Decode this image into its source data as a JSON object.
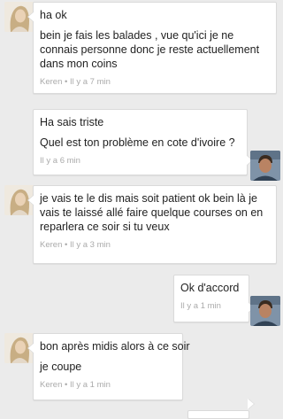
{
  "messages": [
    {
      "sender": "Keren",
      "lines": [
        "ha ok",
        "bein je fais les balades , vue qu'ici je ne connais personne donc je reste actuellement dans mon coins"
      ],
      "meta": "Keren • Il y a 7 min"
    },
    {
      "sender": "me",
      "lines": [
        "Ha sais triste",
        "Quel est ton problème en cote d'ivoire ?"
      ],
      "meta": "Il y a 6 min"
    },
    {
      "sender": "Keren",
      "lines": [
        "je vais te le dis mais soit patient ok bein là je vais te laissé allé faire quelque courses on en reparlera ce soir si tu veux"
      ],
      "meta": "Keren • Il y a 3 min"
    },
    {
      "sender": "me",
      "lines": [
        "Ok d'accord"
      ],
      "meta": "Il y a 1 min"
    },
    {
      "sender": "Keren",
      "lines": [
        "bon après midis alors à ce soir",
        "je coupe"
      ],
      "meta": "Keren • Il y a 1 min"
    }
  ]
}
